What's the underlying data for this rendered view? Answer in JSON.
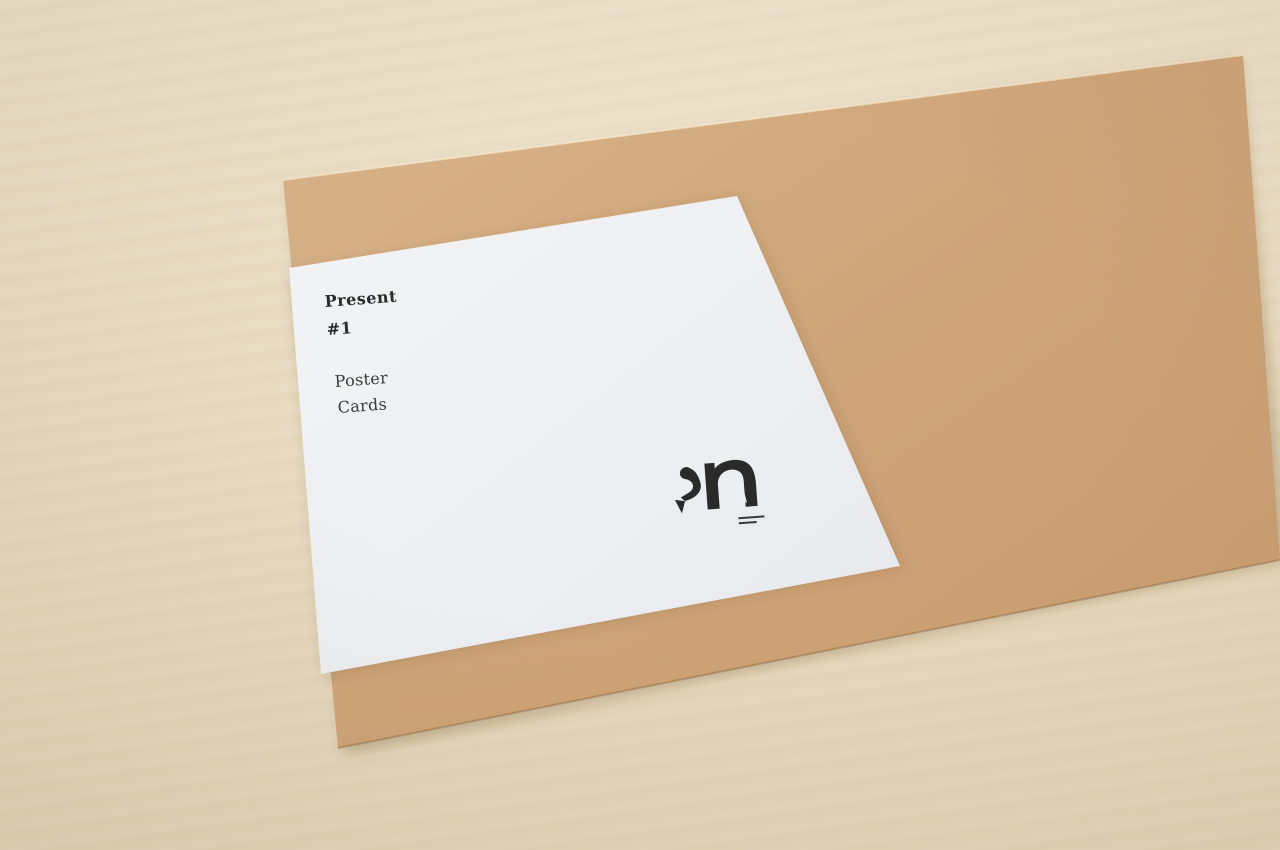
{
  "label": {
    "title_line1": "Present",
    "title_line2": "#1",
    "subtitle_line1": "Poster",
    "subtitle_line2": "Cards"
  },
  "colors": {
    "tabletop": "#e9dcc2",
    "envelope_kraft": "#cfa77b",
    "label_paper": "#eef0f3",
    "ink": "#2b2b2b"
  }
}
